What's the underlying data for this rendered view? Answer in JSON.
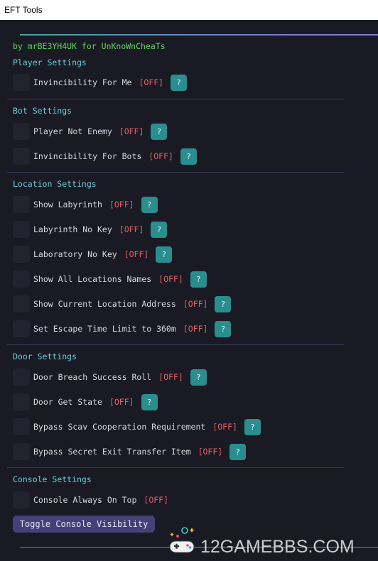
{
  "window": {
    "title": "EFT Tools"
  },
  "credit": "by mrBE3YH4UK for UnKnoWnCheaTs",
  "sections": {
    "player": {
      "title": "Player Settings",
      "items": [
        {
          "label": "Invincibility For Me",
          "state": "[OFF]",
          "help": "?"
        }
      ]
    },
    "bot": {
      "title": "Bot Settings",
      "items": [
        {
          "label": "Player Not Enemy",
          "state": "[OFF]",
          "help": "?"
        },
        {
          "label": "Invincibility For Bots",
          "state": "[OFF]",
          "help": "?"
        }
      ]
    },
    "location": {
      "title": "Location Settings",
      "items": [
        {
          "label": "Show Labyrinth",
          "state": "[OFF]",
          "help": "?"
        },
        {
          "label": "Labyrinth No Key",
          "state": "[OFF]",
          "help": "?"
        },
        {
          "label": "Laboratory No Key",
          "state": "[OFF]",
          "help": "?"
        },
        {
          "label": "Show All Locations Names",
          "state": "[OFF]",
          "help": "?"
        },
        {
          "label": "Show Current Location Address",
          "state": "[OFF]",
          "help": "?"
        },
        {
          "label": "Set Escape Time Limit to 360m",
          "state": "[OFF]",
          "help": "?"
        }
      ]
    },
    "door": {
      "title": "Door Settings",
      "items": [
        {
          "label": "Door Breach Success Roll",
          "state": "[OFF]",
          "help": "?"
        },
        {
          "label": "Door Get State",
          "state": "[OFF]",
          "help": "?"
        },
        {
          "label": "Bypass Scav Cooperation Requirement",
          "state": "[OFF]",
          "help": "?"
        },
        {
          "label": "Bypass Secret Exit Transfer Item",
          "state": "[OFF]",
          "help": "?"
        }
      ]
    },
    "console": {
      "title": "Console Settings",
      "items": [
        {
          "label": "Console Always On Top",
          "state": "[OFF]"
        }
      ],
      "toggle_button": "Toggle Console Visibility"
    }
  },
  "watermark": {
    "text": "12GAMEBBS.COM",
    "icon": "gamepad-icon"
  },
  "colors": {
    "background": "#1a1a24",
    "credit": "#5ad85a",
    "section_title": "#66cdd8",
    "label": "#d8d8e0",
    "off_state": "#e06060",
    "help_button": "#2a8e8e",
    "toggle_button": "#473f78"
  }
}
